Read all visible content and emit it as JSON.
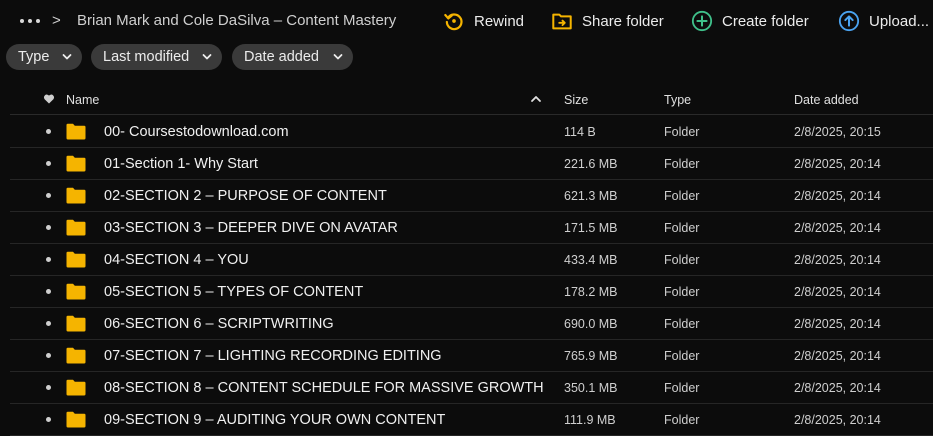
{
  "breadcrumb": {
    "title": "Brian Mark and Cole DaSilva – Content Mastery",
    "separator": ">"
  },
  "actions": {
    "rewind": "Rewind",
    "share_folder": "Share folder",
    "create_folder": "Create folder",
    "upload": "Upload..."
  },
  "filters": {
    "type": "Type",
    "last_modified": "Last modified",
    "date_added": "Date added"
  },
  "table": {
    "headers": {
      "name": "Name",
      "size": "Size",
      "type": "Type",
      "date_added": "Date added"
    },
    "rows": [
      {
        "name": "00- Coursestodownload.com",
        "size": "114 B",
        "type": "Folder",
        "date": "2/8/2025, 20:15"
      },
      {
        "name": "01-Section 1- Why Start",
        "size": "221.6 MB",
        "type": "Folder",
        "date": "2/8/2025, 20:14"
      },
      {
        "name": "02-SECTION 2 – PURPOSE OF CONTENT",
        "size": "621.3 MB",
        "type": "Folder",
        "date": "2/8/2025, 20:14"
      },
      {
        "name": "03-SECTION 3 – DEEPER DIVE ON AVATAR",
        "size": "171.5 MB",
        "type": "Folder",
        "date": "2/8/2025, 20:14"
      },
      {
        "name": "04-SECTION 4 – YOU",
        "size": "433.4 MB",
        "type": "Folder",
        "date": "2/8/2025, 20:14"
      },
      {
        "name": "05-SECTION 5 – TYPES OF CONTENT",
        "size": "178.2 MB",
        "type": "Folder",
        "date": "2/8/2025, 20:14"
      },
      {
        "name": "06-SECTION 6 – SCRIPTWRITING",
        "size": "690.0 MB",
        "type": "Folder",
        "date": "2/8/2025, 20:14"
      },
      {
        "name": "07-SECTION 7 – LIGHTING RECORDING EDITING",
        "size": "765.9 MB",
        "type": "Folder",
        "date": "2/8/2025, 20:14"
      },
      {
        "name": "08-SECTION 8 – CONTENT SCHEDULE FOR MASSIVE GROWTH",
        "size": "350.1 MB",
        "type": "Folder",
        "date": "2/8/2025, 20:14"
      },
      {
        "name": "09-SECTION 9 – AUDITING YOUR OWN CONTENT",
        "size": "111.9 MB",
        "type": "Folder",
        "date": "2/8/2025, 20:14"
      }
    ]
  },
  "colors": {
    "folder": "#f5b400",
    "rewind": "#f5b400",
    "share": "#f5b400",
    "create": "#3fc08a",
    "upload": "#4aa3f0"
  }
}
